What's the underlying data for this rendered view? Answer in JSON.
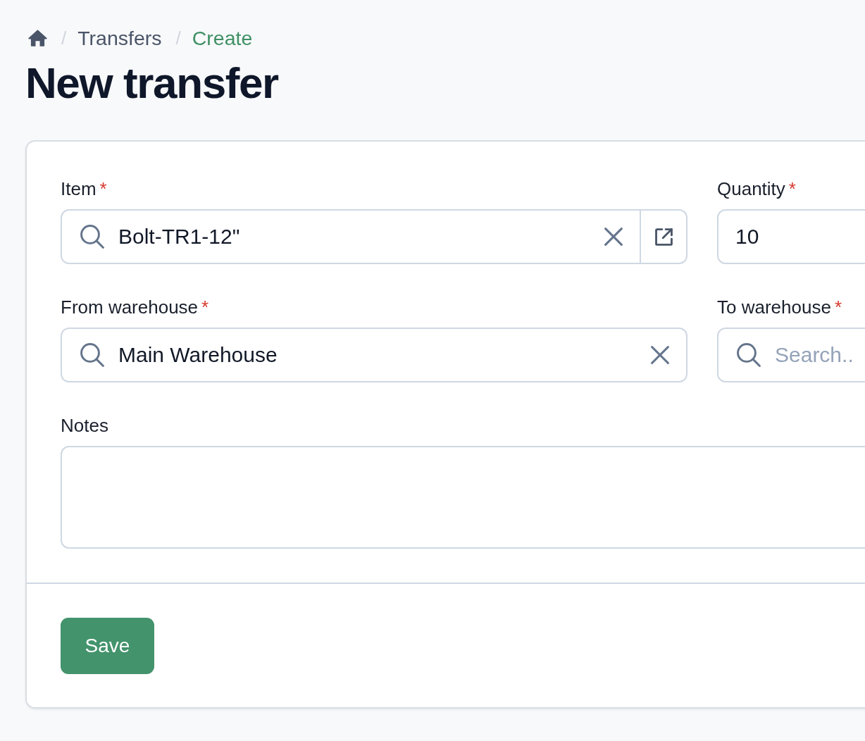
{
  "breadcrumb": {
    "items": [
      {
        "kind": "home",
        "current": false
      },
      {
        "kind": "link",
        "separator": "/",
        "label": "Transfers",
        "current": false
      },
      {
        "kind": "link",
        "separator": "/",
        "label": "Create",
        "current": true
      }
    ]
  },
  "page_title": "New transfer",
  "form": {
    "fields": [
      {
        "kind": "lookup",
        "label": "Item",
        "required_mark": "*",
        "value": "Bolt-TR1-12\"",
        "actions": [
          {
            "kind": "clear"
          },
          {
            "kind": "open_link"
          }
        ]
      },
      {
        "kind": "number",
        "label": "Quantity",
        "required_mark": "*",
        "value": "10"
      },
      {
        "kind": "lookup",
        "label": "From warehouse",
        "required_mark": "*",
        "value": "Main Warehouse",
        "actions": [
          {
            "kind": "clear"
          }
        ]
      },
      {
        "kind": "lookup",
        "label": "To warehouse",
        "required_mark": "*",
        "placeholder": "Search.."
      },
      {
        "kind": "textarea",
        "label": "Notes"
      }
    ]
  },
  "footer": {
    "buttons": [
      {
        "label": "Save",
        "kind": "primary"
      }
    ]
  }
}
